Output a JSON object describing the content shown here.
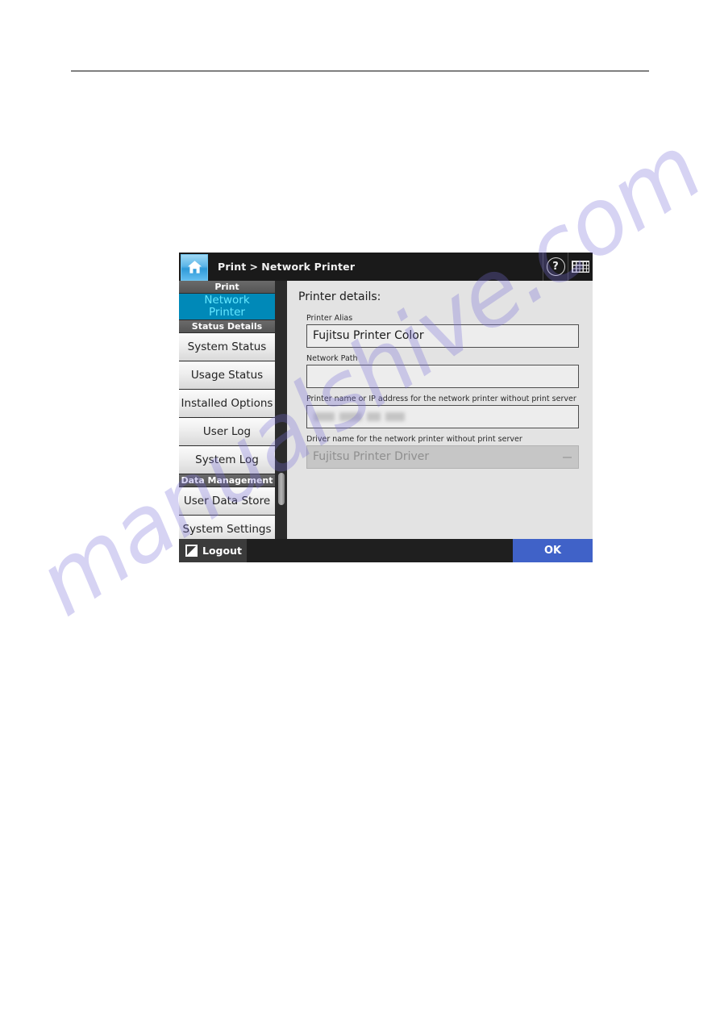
{
  "document": {
    "rule": "horizontal-rule",
    "watermark_text": "manualshive.com"
  },
  "device": {
    "header": {
      "home_icon": "home-icon",
      "breadcrumb": {
        "root": "Print",
        "separator": ">",
        "current": "Network Printer"
      },
      "help_icon": "help-icon",
      "help_glyph": "?",
      "keyboard_icon": "keyboard-icon"
    },
    "sidebar": {
      "items": [
        {
          "label": "Print",
          "type": "group"
        },
        {
          "label": "Network\nPrinter",
          "line1": "Network",
          "line2": "Printer",
          "type": "selected"
        },
        {
          "label": "Status Details",
          "type": "group"
        },
        {
          "label": "System Status",
          "type": "button"
        },
        {
          "label": "Usage Status",
          "type": "button"
        },
        {
          "label": "Installed Options",
          "type": "button"
        },
        {
          "label": "User Log",
          "type": "button"
        },
        {
          "label": "System Log",
          "type": "button"
        },
        {
          "label": "Data Management",
          "type": "group"
        },
        {
          "label": "User Data Store",
          "type": "button"
        },
        {
          "label": "System Settings",
          "type": "button"
        }
      ]
    },
    "content": {
      "title": "Printer details:",
      "fields": [
        {
          "label": "Printer Alias",
          "value": "Fujitsu Printer Color",
          "state": "editable"
        },
        {
          "label": "Network Path",
          "value": "",
          "state": "editable"
        },
        {
          "label": "Printer name or IP address for the network printer without print server",
          "value": "",
          "state": "redacted"
        },
        {
          "label": "Driver name for the network printer without print server",
          "value": "Fujitsu Printer Driver",
          "state": "disabled-dropdown"
        }
      ]
    },
    "footer": {
      "logout_icon": "logout-icon",
      "logout_label": "Logout",
      "ok_label": "OK"
    },
    "colors": {
      "accent_selected": "#0089b8",
      "accent_selected_text": "#63e6ff",
      "ok_button": "#4062c8",
      "header_bar": "#1a1a1a",
      "content_bg": "#e3e3e3"
    }
  }
}
